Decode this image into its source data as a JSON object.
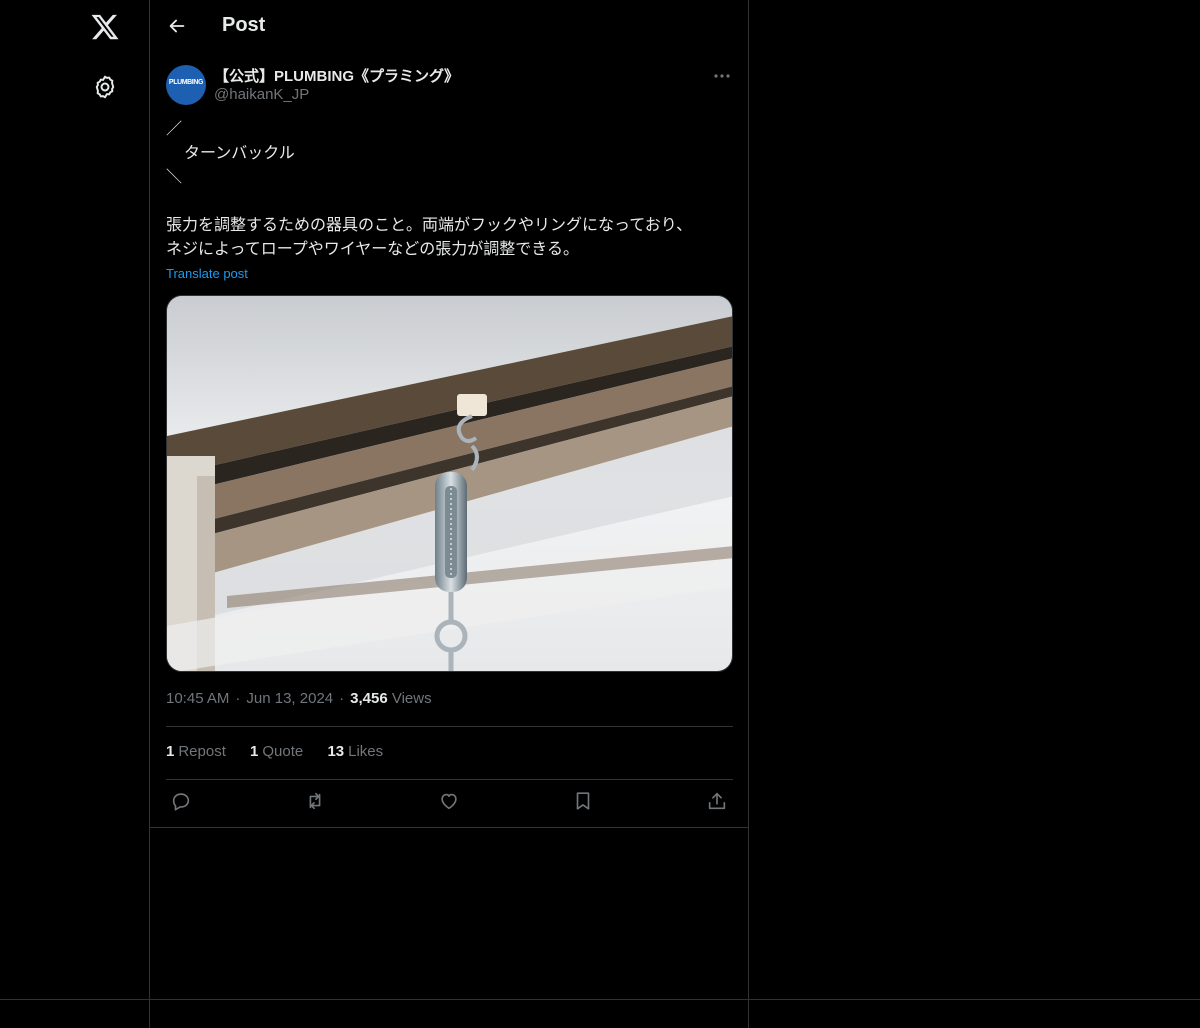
{
  "sidebar": {
    "logo_icon": "x-logo-icon",
    "settings_icon": "gear-icon"
  },
  "header": {
    "back_icon": "arrow-left-icon",
    "title": "Post"
  },
  "author": {
    "avatar_text": "PLUMBING",
    "display_name": "【公式】PLUMBING《プラミング》",
    "handle": "@haikanK_JP",
    "more_icon": "more-horizontal-icon"
  },
  "post": {
    "line1": "／",
    "line2": "ターンバックル",
    "line3": "＼",
    "line4": "張力を調整するための器具のこと。両端がフックやリングになっており、",
    "line5": "ネジによってロープやワイヤーなどの張力が調整できる。",
    "translate_label": "Translate post",
    "image_description_icon": "photo-turnbuckle"
  },
  "meta": {
    "time": "10:45 AM",
    "date": "Jun 13, 2024",
    "separator": "·",
    "views_count": "3,456",
    "views_label": "Views"
  },
  "stats": {
    "reposts_count": "1",
    "reposts_label": "Repost",
    "quotes_count": "1",
    "quotes_label": "Quote",
    "likes_count": "13",
    "likes_label": "Likes"
  },
  "actions": {
    "reply_icon": "reply-icon",
    "repost_icon": "repost-icon",
    "like_icon": "heart-icon",
    "bookmark_icon": "bookmark-icon",
    "share_icon": "share-icon"
  },
  "colors": {
    "background": "#000000",
    "text": "#e7e9ea",
    "secondary": "#71767b",
    "link": "#1d9bf0",
    "border": "#2f3336"
  }
}
